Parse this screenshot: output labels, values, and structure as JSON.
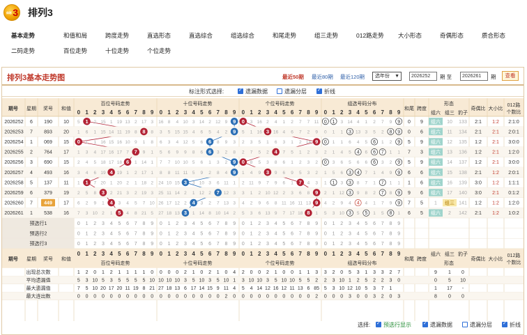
{
  "app": {
    "title": "排列3",
    "logo_text": "3",
    "logo_sub": "体彩"
  },
  "nav": {
    "row1": [
      "基本走势",
      "和值和局",
      "跨度走势",
      "直选形态",
      "直选综合",
      "组选综合",
      "和尾走势",
      "组三走势",
      "012路走势",
      "大小形态",
      "奇偶形态",
      "质合形态"
    ],
    "row2": [
      "二码走势",
      "百位走势",
      "十位走势",
      "个位走势"
    ]
  },
  "panel": {
    "title": "排列3基本走势图",
    "ranges": [
      "最近50期",
      "最近80期",
      "最近120期"
    ],
    "year_select": "选年份",
    "from_issue": "2026252",
    "to_label_from": "期 至",
    "to_issue": "2026261",
    "to_label_end": "期",
    "query": "查看"
  },
  "options": {
    "label": "标注形式选择:",
    "items": [
      {
        "label": "遗漏数据",
        "checked": true
      },
      {
        "label": "遗漏分层",
        "checked": false
      },
      {
        "label": "折线",
        "checked": true
      }
    ]
  },
  "table_head": {
    "issue": "期号",
    "week": "星期",
    "prize": "奖号",
    "sum": "和值",
    "bai": "百位号码走势",
    "shi": "十位号码走势",
    "ge": "个位号码走势",
    "zu": "组选号码分布",
    "hewei": "和尾",
    "kuadu": "跨度",
    "xingtai": "形态",
    "zu6": "组六",
    "zu3": "组三",
    "baozi": "豹子",
    "jiou": "奇偶比",
    "daxiao": "大小比",
    "lu012": "012路",
    "lu012b": "个数比",
    "digits": [
      "0",
      "1",
      "2",
      "3",
      "4",
      "5",
      "6",
      "7",
      "8",
      "9"
    ]
  },
  "rows": [
    {
      "issue": "2026252",
      "week": "6",
      "prize": "190",
      "sum": "10",
      "d": [
        1,
        9,
        0
      ],
      "bai": [
        5,
        1,
        2,
        15,
        1,
        19,
        13,
        2,
        17,
        3
      ],
      "shi": [
        16,
        8,
        4,
        10,
        3,
        14,
        2,
        12,
        9,
        1
      ],
      "ge": [
        1,
        3,
        16,
        2,
        4,
        1,
        2,
        7,
        7,
        11
      ],
      "zu": "1 1 3 14 4 1 2 7 9 11",
      "hw": "0",
      "kd": "9",
      "x": "组六",
      "z3": "10",
      "bz": "133",
      "jo": "2:1",
      "dx": "1:2",
      "lu": "2:1:0"
    },
    {
      "issue": "2026253",
      "week": "7",
      "prize": "893",
      "sum": "20",
      "d": [
        8,
        9,
        3
      ],
      "bai": [
        1,
        6,
        1,
        15,
        14,
        11,
        19,
        8,
        2,
        8
      ],
      "shi": [
        3,
        5,
        15,
        15,
        4,
        6,
        5,
        4,
        2,
        9
      ],
      "ge": [
        5,
        1,
        16,
        3,
        16,
        4,
        6,
        7,
        2,
        9
      ],
      "zu": "0 1 1 3 13 3 5 2 8 9",
      "hw": "0",
      "kd": "6",
      "x": "组六",
      "z3": "11",
      "bz": "134",
      "jo": "2:1",
      "dx": "2:1",
      "lu": "2:0:1"
    },
    {
      "issue": "2026254",
      "week": "1",
      "prize": "069",
      "sum": "15",
      "d": [
        0,
        6,
        9
      ],
      "bai": [
        0,
        1,
        1,
        16,
        15,
        16,
        10,
        9,
        1,
        8
      ],
      "shi": [
        6,
        3,
        4,
        12,
        5,
        6,
        4,
        8,
        9,
        3
      ],
      "ge": [
        2,
        3,
        5,
        1,
        6,
        3,
        1,
        2,
        14,
        9
      ],
      "zu": "0 1 1 6 4 5 6 1 2 9",
      "hw": "5",
      "kd": "9",
      "x": "组六",
      "z3": "12",
      "bz": "135",
      "jo": "1:2",
      "dx": "2:1",
      "lu": "3:0:0"
    },
    {
      "issue": "2026255",
      "week": "2",
      "prize": "764",
      "sum": "17",
      "d": [
        7,
        6,
        4
      ],
      "bai": [
        1,
        3,
        4,
        17,
        16,
        17,
        7,
        10,
        9,
        1
      ],
      "shi": [
        5,
        6,
        9,
        9,
        8,
        6,
        6,
        3,
        2,
        8
      ],
      "ge": [
        2,
        7,
        5,
        2,
        4,
        7,
        5,
        1,
        2,
        3
      ],
      "zu": "2 1 4 5 3 6 7 2 1 1",
      "hw": "7",
      "kd": "3",
      "x": "组六",
      "z3": "13",
      "bz": "136",
      "jo": "1:2",
      "dx": "2:1",
      "lu": "1:2:0"
    },
    {
      "issue": "2026256",
      "week": "3",
      "prize": "690",
      "sum": "15",
      "d": [
        6,
        9,
        0
      ],
      "bai": [
        2,
        4,
        5,
        18,
        17,
        18,
        6,
        1,
        14,
        1
      ],
      "shi": [
        7,
        7,
        10,
        10,
        5,
        6,
        1,
        3,
        2,
        9
      ],
      "ge": [
        0,
        8,
        5,
        3,
        8,
        6,
        1,
        2,
        3,
        2
      ],
      "zu": "0 3 6 5 6 6 1 3 2 9",
      "hw": "5",
      "kd": "9",
      "x": "组六",
      "z3": "14",
      "bz": "137",
      "jo": "1:2",
      "dx": "2:1",
      "lu": "3:0:0"
    },
    {
      "issue": "2026257",
      "week": "4",
      "prize": "493",
      "sum": "16",
      "d": [
        4,
        9,
        3
      ],
      "bai": [
        3,
        4,
        6,
        19,
        4,
        19,
        1,
        2,
        17,
        1
      ],
      "shi": [
        8,
        8,
        11,
        11,
        5,
        9,
        2,
        8,
        4,
        9
      ],
      "ge": [
        1,
        4,
        9,
        3,
        9,
        6,
        9,
        5,
        3,
        2
      ],
      "zu": "1 5 6 3 4 7 1 4 9 9",
      "hw": "6",
      "kd": "6",
      "x": "组六",
      "z3": "15",
      "bz": "138",
      "jo": "2:1",
      "dx": "1:2",
      "lu": "2:0:1"
    },
    {
      "issue": "2026258",
      "week": "5",
      "prize": "137",
      "sum": "11",
      "d": [
        1,
        3,
        7
      ],
      "bai": [
        1,
        6,
        7,
        20,
        1,
        20,
        2,
        1,
        18,
        2
      ],
      "shi": [
        24,
        10,
        15,
        3,
        3,
        10,
        3,
        6,
        11,
        1
      ],
      "ge": [
        2,
        11,
        9,
        7,
        9,
        6,
        1,
        7,
        4,
        3
      ],
      "zu": "1 7 3 1 8 7 1 5 1 1",
      "hw": "1",
      "kd": "6",
      "x": "组六",
      "z3": "16",
      "bz": "139",
      "jo": "3:0",
      "dx": "1:2",
      "lu": "1:1:1"
    },
    {
      "issue": "2026259",
      "week": "6",
      "prize": "379",
      "sum": "19",
      "d": [
        3,
        7,
        9
      ],
      "bai": [
        2,
        5,
        8,
        3,
        2,
        21,
        3,
        2,
        19,
        3
      ],
      "shi": [
        25,
        11,
        14,
        2,
        1,
        12,
        2,
        7,
        12,
        3
      ],
      "ge": [
        3,
        1,
        2,
        10,
        12,
        2,
        3,
        6,
        8,
        9
      ],
      "zu": "2 1 12 3 9 8 2 7 8 9",
      "hw": "9",
      "kd": "6",
      "x": "组六",
      "z3": "17",
      "bz": "140",
      "jo": "3:0",
      "dx": "2:1",
      "lu": "0:1:2"
    },
    {
      "issue": "2026260",
      "week": "7",
      "prize": "449",
      "sum": "17",
      "d": [
        4,
        4,
        9
      ],
      "bai": [
        6,
        2,
        9,
        1,
        4,
        3,
        4,
        5,
        7,
        10
      ],
      "shi": [
        26,
        17,
        12,
        2,
        4,
        3,
        2,
        7,
        13,
        3
      ],
      "ge": [
        4,
        2,
        9,
        6,
        8,
        11,
        16,
        11,
        13,
        9
      ],
      "zu": "4 2 9 4 10 4 1 7 9 9",
      "hw": "7",
      "kd": "5",
      "x": "组三",
      "z3": "1",
      "bz": "141",
      "jo": "1:2",
      "dx": "1:2",
      "lu": "1:2:0"
    },
    {
      "issue": "2026261",
      "week": "1",
      "prize": "538",
      "sum": "16",
      "d": [
        5,
        3,
        8
      ],
      "bai": [
        7,
        3,
        10,
        2,
        1,
        5,
        4,
        8,
        21,
        5
      ],
      "shi": [
        27,
        18,
        13,
        3,
        1,
        14,
        8,
        10,
        14,
        2
      ],
      "ge": [
        5,
        3,
        6,
        13,
        9,
        7,
        17,
        18,
        8,
        1
      ],
      "zu": "5 3 10 3 5 5 1 5 8 1",
      "hw": "6",
      "kd": "5",
      "x": "组六",
      "z3": "2",
      "bz": "142",
      "jo": "2:1",
      "dx": "1:2",
      "lu": "1:0:2"
    }
  ],
  "forecast_rows": [
    "预选行1",
    "预选行2",
    "预选行3"
  ],
  "stats": [
    {
      "label": "出现总次数",
      "bai": [
        1,
        2,
        0,
        1,
        2,
        1,
        1,
        1,
        1,
        0
      ],
      "shi": [
        0,
        0,
        0,
        2,
        1,
        0,
        2,
        1,
        0,
        4
      ],
      "ge": [
        2,
        0,
        0,
        2,
        1,
        0,
        0,
        1,
        1,
        3
      ],
      "zu": "3 2 0 5 3 1 3 3 2 7",
      "z6": "9",
      "z3": "1",
      "bz": "0"
    },
    {
      "label": "平均遗漏值",
      "bai": [
        5,
        3,
        10,
        5,
        3,
        5,
        5,
        5,
        5,
        10
      ],
      "shi": [
        10,
        10,
        10,
        3,
        5,
        10,
        3,
        5,
        10,
        1
      ],
      "ge": [
        3,
        10,
        10,
        3,
        5,
        10,
        10,
        5,
        5,
        2
      ],
      "zu": "2 3 10 1 2 5 2 2 3 0",
      "z6": "0",
      "z3": "5",
      "bz": "10"
    },
    {
      "label": "最大遗漏值",
      "bai": [
        7,
        5,
        10,
        20,
        17,
        20,
        11,
        19,
        8,
        21
      ],
      "shi": [
        27,
        18,
        13,
        6,
        17,
        14,
        15,
        9,
        11,
        4
      ],
      "ge": [
        5,
        4,
        14,
        12,
        16,
        12,
        11,
        13,
        6,
        85
      ],
      "zu": "5 3 10 12 10 5 3 7 1",
      "z6": "1",
      "z3": "17",
      "bz": "-"
    },
    {
      "label": "最大连出数",
      "bai": [
        0,
        0,
        0,
        0,
        0,
        0,
        0,
        0,
        0,
        0
      ],
      "shi": [
        0,
        0,
        0,
        0,
        0,
        0,
        0,
        0,
        2,
        0
      ],
      "ge": [
        0,
        0,
        0,
        0,
        0,
        0,
        0,
        0,
        0,
        2
      ],
      "zu": "0 0 0 3 0 0 3 2 0 3",
      "z6": "8",
      "z3": "0",
      "bz": "0"
    }
  ],
  "footer": {
    "label": "选择:",
    "items": [
      {
        "label": "预选行显示",
        "checked": true
      },
      {
        "label": "遗漏数据",
        "checked": true
      },
      {
        "label": "遗漏分层",
        "checked": false
      },
      {
        "label": "折线",
        "checked": true
      }
    ]
  },
  "colors": {
    "red": "#b22234",
    "blue": "#2c6fb5",
    "head_bg": "#f8ead5",
    "head_line": "#e3cfa8",
    "cell_line": "#eee4d6",
    "grey_text": "#aaa",
    "orange": "#e8a33a",
    "xingtai_bg": "#9fd4cc"
  }
}
